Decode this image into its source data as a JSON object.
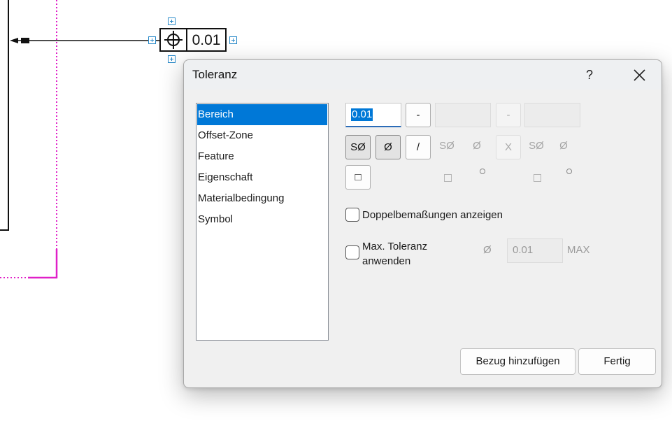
{
  "canvas": {
    "fcf_value": "0.01",
    "accent_line": "#e020c8",
    "grip_color": "#2a8ac9"
  },
  "dialog": {
    "title": "Toleranz",
    "help_label": "?",
    "close_icon": "close-icon",
    "categories": [
      {
        "label": "Bereich",
        "selected": true
      },
      {
        "label": "Offset-Zone",
        "selected": false
      },
      {
        "label": "Feature",
        "selected": false
      },
      {
        "label": "Eigenschaft",
        "selected": false
      },
      {
        "label": "Materialbedingung",
        "selected": false
      },
      {
        "label": "Symbol",
        "selected": false
      }
    ],
    "tolerance_value": "0.01",
    "minus1_label": "-",
    "minus2_label": "-",
    "so_label": "SØ",
    "dia_label": "Ø",
    "slash_label": "/",
    "x_label": "X",
    "so_dim1": "SØ",
    "dia_dim1": "Ø",
    "so_dim2": "SØ",
    "dia_dim2": "Ø",
    "square_label": "□",
    "dual_dim_label": "Doppelbemaßungen anzeigen",
    "max_tol_label_line1": "Max. Toleranz",
    "max_tol_label_line2": "anwenden",
    "max_dia_glyph": "Ø",
    "max_value": "0.01",
    "max_unit": "MAX",
    "add_datum_label": "Bezug hinzufügen",
    "done_label": "Fertig",
    "accent": "#0078d7"
  }
}
